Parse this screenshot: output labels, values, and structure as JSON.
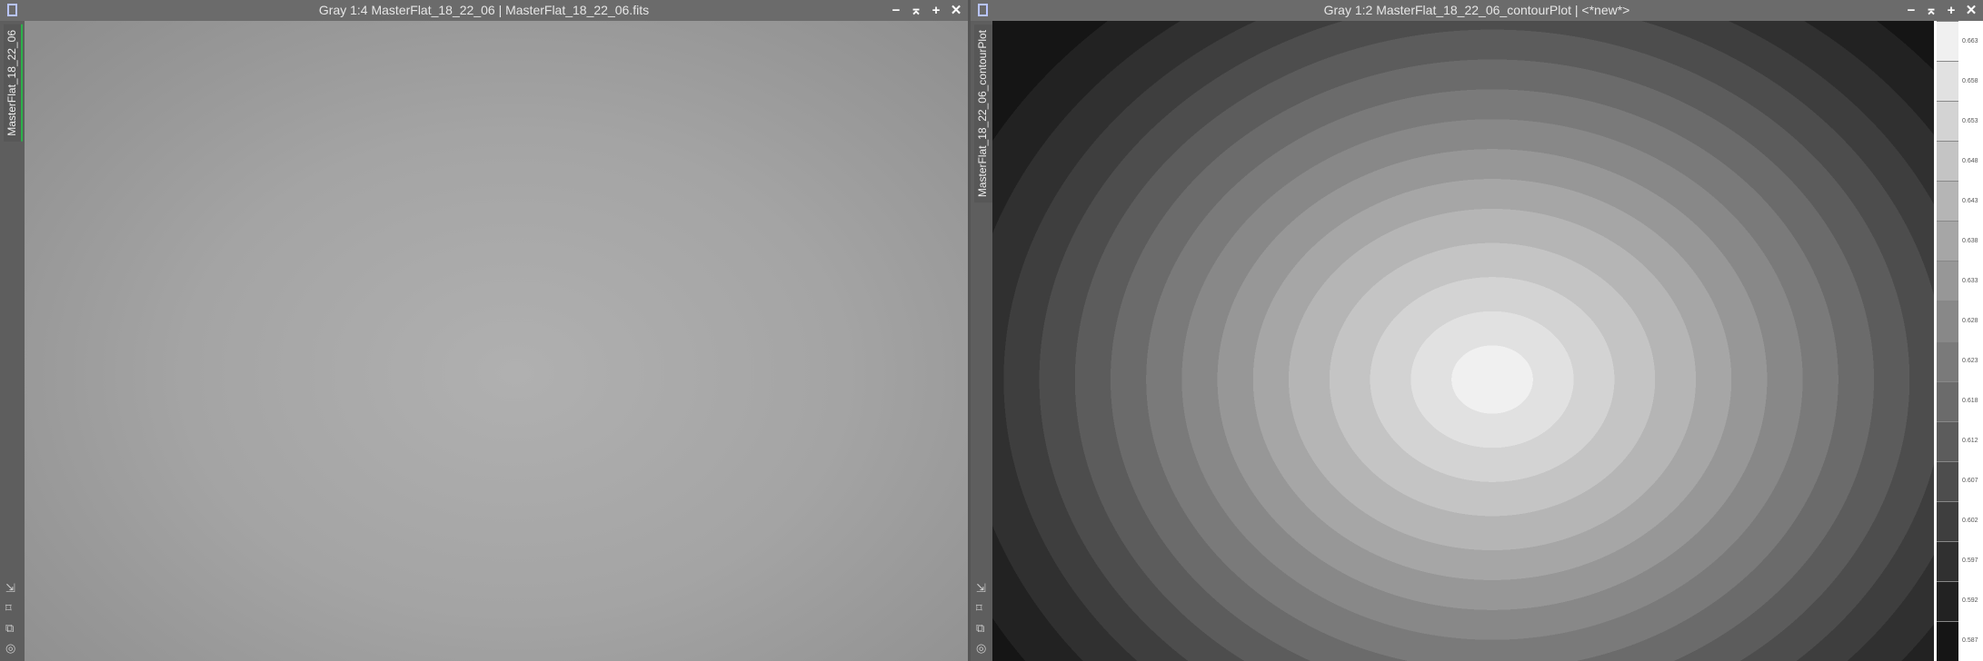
{
  "left_window": {
    "title": "Gray 1:4 MasterFlat_18_22_06 | MasterFlat_18_22_06.fits",
    "tab": "MasterFlat_18_22_06",
    "controls": [
      "−",
      "⌅",
      "+",
      "✕"
    ]
  },
  "right_window": {
    "title": "Gray 1:2 MasterFlat_18_22_06_contourPlot | <*new*>",
    "tab": "MasterFlat_18_22_06_contourPlot",
    "controls": [
      "−",
      "⌅",
      "+",
      "✕"
    ]
  },
  "tools": [
    "⇲",
    "⌑",
    "⧉",
    "◎"
  ],
  "colorbar": {
    "levels": [
      {
        "label": "0.663",
        "color": "#f0f0f0"
      },
      {
        "label": "0.658",
        "color": "#e1e1e1"
      },
      {
        "label": "0.653",
        "color": "#d3d3d3"
      },
      {
        "label": "0.648",
        "color": "#c4c4c4"
      },
      {
        "label": "0.643",
        "color": "#b5b5b5"
      },
      {
        "label": "0.638",
        "color": "#a6a6a6"
      },
      {
        "label": "0.633",
        "color": "#979797"
      },
      {
        "label": "0.628",
        "color": "#888888"
      },
      {
        "label": "0.623",
        "color": "#7a7a7a"
      },
      {
        "label": "0.618",
        "color": "#6b6b6b"
      },
      {
        "label": "0.612",
        "color": "#5c5c5c"
      },
      {
        "label": "0.607",
        "color": "#4d4d4d"
      },
      {
        "label": "0.602",
        "color": "#3e3e3e"
      },
      {
        "label": "0.597",
        "color": "#303030"
      },
      {
        "label": "0.592",
        "color": "#222222"
      },
      {
        "label": "0.587",
        "color": "#151515"
      }
    ]
  }
}
